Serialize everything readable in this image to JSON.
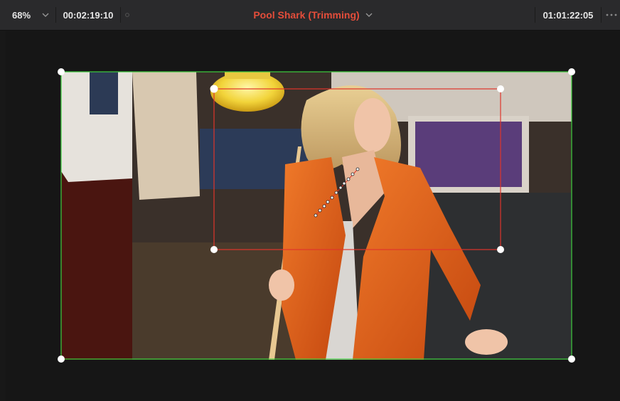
{
  "toolbar": {
    "zoom": "68%",
    "source_timecode": "00:02:19:10",
    "clip_title": "Pool Shark (Trimming)",
    "record_timecode": "01:01:22:05"
  },
  "icons": {
    "zoom_menu": "chevron-down-icon",
    "title_menu": "chevron-down-icon",
    "separator": "dot-icon",
    "options": "ellipsis-icon"
  },
  "colors": {
    "toolbar_bg": "#2a2a2c",
    "viewer_bg": "#161616",
    "title_red": "#e44d3a",
    "timecode_white": "#e6e6e6",
    "outer_box_green": "#3ecf3e",
    "inner_box_red": "#e0352b",
    "handle_white": "#ffffff"
  }
}
